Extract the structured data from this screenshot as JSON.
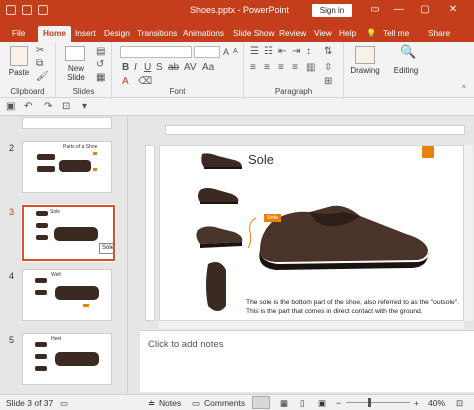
{
  "window": {
    "title": "Shoes.pptx  -  PowerPoint",
    "sign_in": "Sign in",
    "minimize": "—",
    "restore": "▢",
    "close": "✕"
  },
  "ribbon_tabs": [
    "File",
    "Home",
    "Insert",
    "Design",
    "Transitions",
    "Animations",
    "Slide Show",
    "Review",
    "View",
    "Help"
  ],
  "tell_me": "Tell me",
  "share": "Share",
  "ribbon": {
    "paste": "Paste",
    "new_slide_line1": "New",
    "new_slide_line2": "Slide",
    "clipboard": "Clipboard",
    "slides": "Slides",
    "font": "Font",
    "paragraph": "Paragraph",
    "drawing": "Drawing",
    "editing": "Editing"
  },
  "thumbnails": [
    {
      "num": "2",
      "title": "Parts of a Shoe"
    },
    {
      "num": "3",
      "title": "Sole"
    },
    {
      "num": "4",
      "title": "Welt"
    },
    {
      "num": "5",
      "title": "Heel"
    }
  ],
  "thumb_tooltip": "Sole",
  "slide": {
    "title": "Sole",
    "callout": "Sole",
    "caption": "The sole is the bottom part of the shoe, also referred to as the \"outsole\". This is the part that comes in direct contact with the ground."
  },
  "notes_placeholder": "Click to add notes",
  "status": {
    "slide_indicator": "Slide 3 of 37",
    "notes": "Notes",
    "comments": "Comments",
    "zoom_value": "40%"
  },
  "colors": {
    "accent": "#c43e1c",
    "orange": "#e8820c",
    "selected_border": "#d35230"
  }
}
